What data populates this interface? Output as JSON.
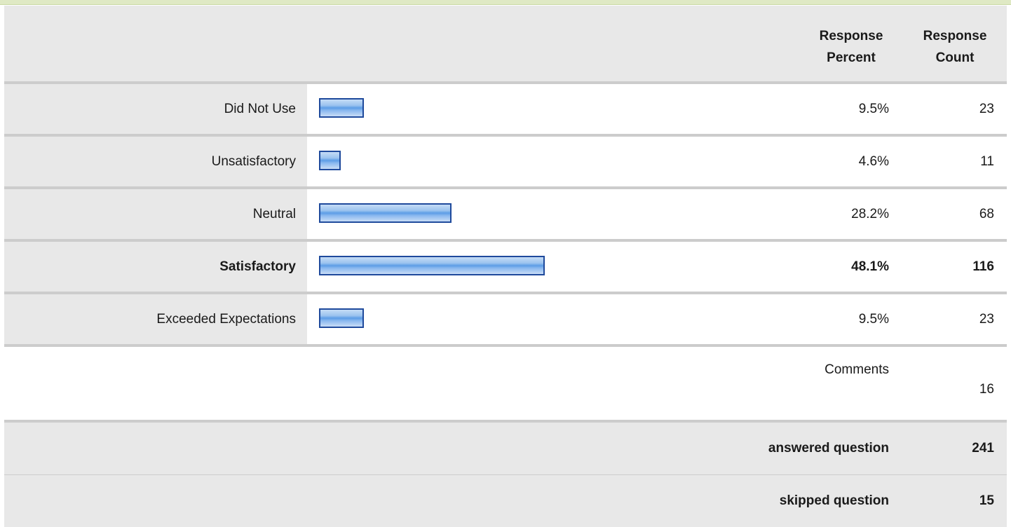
{
  "header": {
    "response_percent": "Response\nPercent",
    "response_count": "Response\nCount"
  },
  "rows": [
    {
      "label": "Did Not Use",
      "percent": "9.5%",
      "count": "23",
      "fraction": 0.095,
      "bold": false
    },
    {
      "label": "Unsatisfactory",
      "percent": "4.6%",
      "count": "11",
      "fraction": 0.046,
      "bold": false
    },
    {
      "label": "Neutral",
      "percent": "28.2%",
      "count": "68",
      "fraction": 0.282,
      "bold": false
    },
    {
      "label": "Satisfactory",
      "percent": "48.1%",
      "count": "116",
      "fraction": 0.481,
      "bold": true
    },
    {
      "label": "Exceeded Expectations",
      "percent": "9.5%",
      "count": "23",
      "fraction": 0.095,
      "bold": false
    }
  ],
  "comments": {
    "label": "Comments",
    "count": "16"
  },
  "summary": {
    "answered_label": "answered question",
    "answered_count": "241",
    "skipped_label": "skipped question",
    "skipped_count": "15"
  }
}
